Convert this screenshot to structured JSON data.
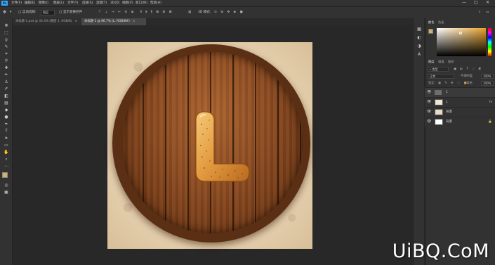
{
  "app": {
    "logo": "Ps"
  },
  "menu": [
    "文件(F)",
    "编辑(E)",
    "图像(I)",
    "图层(L)",
    "文字(Y)",
    "选择(S)",
    "滤镜(T)",
    "3D(D)",
    "视图(V)",
    "窗口(W)",
    "帮助(H)"
  ],
  "window_controls": [
    "—",
    "□",
    "✕"
  ],
  "options_bar": {
    "mode_label": "自动选择:",
    "mode_value": "图层",
    "transform_label": "显示变换控件",
    "mode3d": "3D 模式:"
  },
  "tabs": [
    {
      "label": "未标题-1.psd @ 33.3% (图层 1, RGB/8)",
      "active": false
    },
    {
      "label": "未标题-1 @ 66.7% (L, RGB/8#)",
      "active": true
    }
  ],
  "right_panel": {
    "color_tabs": [
      "颜色",
      "色板"
    ],
    "layers_tabs": [
      "图层",
      "通道",
      "路径"
    ],
    "kind_value": "类型",
    "blend_value": "正常",
    "opacity_label": "不透明度:",
    "opacity_value": "100%",
    "lock_label": "锁定:",
    "fill_label": "填充:",
    "fill_value": "100%",
    "colors": {
      "foreground": "#d4b06a",
      "background": "#ffffff",
      "accent": "#e6a22b"
    }
  },
  "layers": [
    {
      "name": "1",
      "thumb": "folder",
      "fx": ""
    },
    {
      "name": "L",
      "thumb": "#f0e6d8",
      "fx": "fx"
    },
    {
      "name": "背景",
      "thumb": "#e9dcc6",
      "fx": ""
    },
    {
      "name": "背景",
      "thumb": "#ffffff",
      "fx": "🔒"
    }
  ],
  "canvas": {
    "letter": "L"
  },
  "watermark": "UiBQ.CoM"
}
